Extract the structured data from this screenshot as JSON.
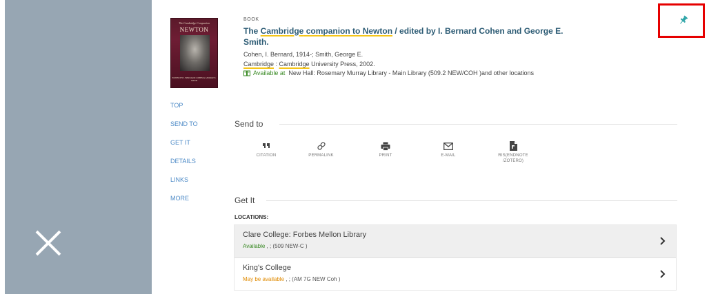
{
  "close_button": {
    "icon": "close-icon"
  },
  "record": {
    "type": "BOOK",
    "title_pre": "The ",
    "title_link1": "Cambridge",
    "title_mid": " companion to Newton",
    "title_post": " / edited by I. Bernard Cohen and George E. Smith.",
    "author": "Cohen, I. Bernard, 1914-; Smith, George E.",
    "publisher_place": "Cambridge",
    "publisher_sep": " : ",
    "publisher_name": "Cambridge",
    "publisher_rest": " University Press, 2002.",
    "availability_label": "Available at",
    "availability_location": "New Hall: Rosemary Murray Library - Main Library (509.2 NEW/COH )and other locations"
  },
  "cover": {
    "top_text": "The Cambridge Companion",
    "title_text": "NEWTON",
    "bottom_text": "EDITED BY I. BERNARD COHEN & GEORGE E. SMITH"
  },
  "pin": {
    "icon": "pin-icon",
    "color": "#2aa3a6"
  },
  "sidenav": [
    "TOP",
    "SEND TO",
    "GET IT",
    "DETAILS",
    "LINKS",
    "MORE"
  ],
  "send_to": {
    "heading": "Send to",
    "actions": [
      {
        "label": "CITATION",
        "icon": "quote-icon"
      },
      {
        "label": "PERMALINK",
        "icon": "link-icon"
      },
      {
        "label": "PRINT",
        "icon": "printer-icon"
      },
      {
        "label": "E-MAIL",
        "icon": "envelope-icon"
      },
      {
        "label": "RIS(ENDNOTE\n/ZOTERO)",
        "icon": "file-icon"
      }
    ]
  },
  "get_it": {
    "heading": "Get It",
    "locations_label": "LOCATIONS:",
    "locations": [
      {
        "name": "Clare College: Forbes Mellon Library",
        "status": "Available",
        "detail": " , ; (509 NEW-C )"
      },
      {
        "name": "King's College",
        "status": "May be available",
        "detail": " , ; (AM 7G NEW Coh )"
      }
    ]
  },
  "colors": {
    "sidebar_grey": "#97a6b3",
    "title_blue": "#2c5b74",
    "nav_blue": "#4b89c6",
    "available_green": "#3a8a25",
    "maybe_orange": "#e08a00",
    "highlight_red": "#e60000"
  }
}
